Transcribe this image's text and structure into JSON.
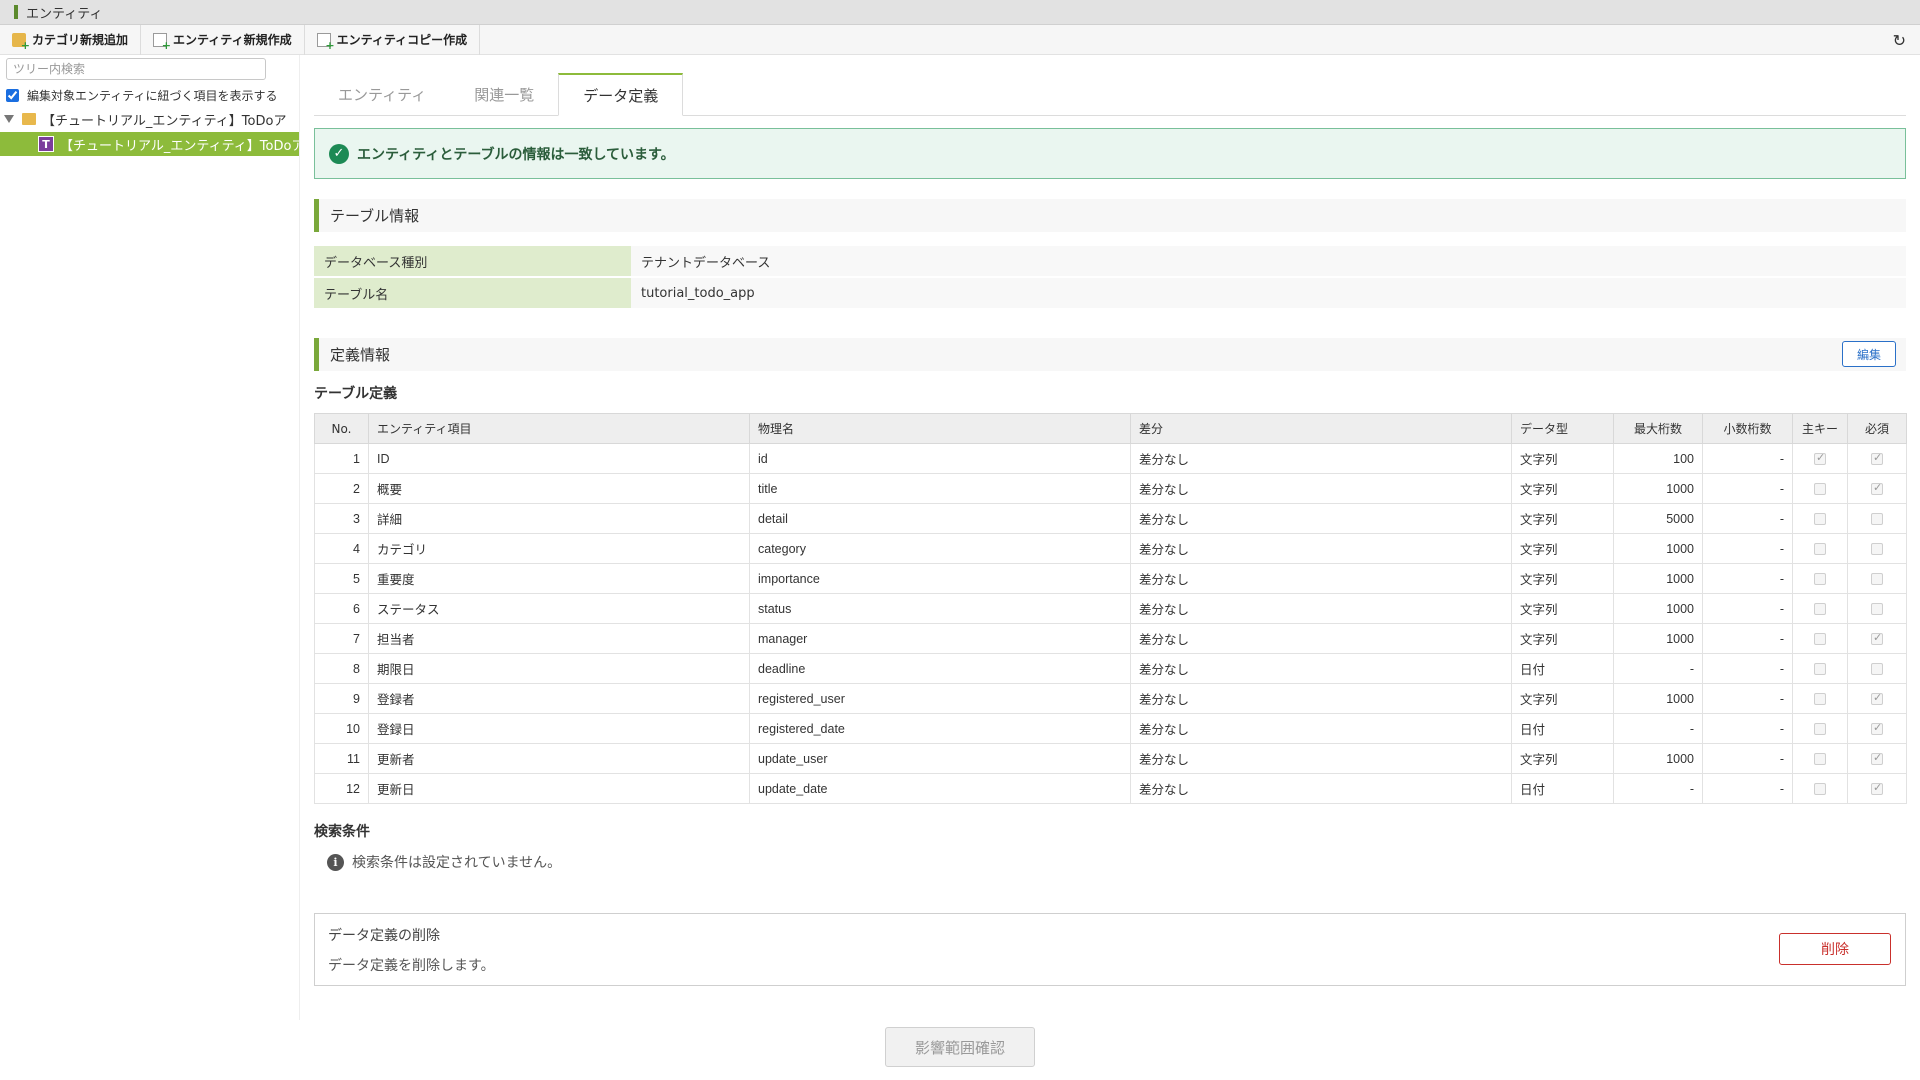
{
  "window": {
    "title": "エンティティ"
  },
  "toolbar": {
    "items": [
      {
        "label": "カテゴリ新規追加",
        "icon": "folder-add-icon"
      },
      {
        "label": "エンティティ新規作成",
        "icon": "document-add-icon"
      },
      {
        "label": "エンティティコピー作成",
        "icon": "document-copy-icon"
      }
    ],
    "refresh_icon": "refresh-icon"
  },
  "sidebar": {
    "search_placeholder": "ツリー内検索",
    "checkbox_label": "編集対象エンティティに紐づく項目を表示する",
    "checkbox_checked": true,
    "category_node": "【チュートリアル_エンティティ】ToDoア",
    "entity_node": "【チュートリアル_エンティティ】ToDoア",
    "entity_icon_letter": "T",
    "scroll_left": "◂",
    "scroll_right": "▸"
  },
  "tabs": [
    {
      "label": "エンティティ",
      "active": false
    },
    {
      "label": "関連一覧",
      "active": false
    },
    {
      "label": "データ定義",
      "active": true
    }
  ],
  "alert": {
    "icon": "✓",
    "text": "エンティティとテーブルの情報は一致しています。"
  },
  "table_info": {
    "heading": "テーブル情報",
    "rows": [
      {
        "key": "データベース種別",
        "value": "テナントデータベース"
      },
      {
        "key": "テーブル名",
        "value": "tutorial_todo_app"
      }
    ]
  },
  "definition": {
    "heading": "定義情報",
    "edit_label": "編集",
    "table_title": "テーブル定義",
    "columns": [
      "No.",
      "エンティティ項目",
      "物理名",
      "差分",
      "データ型",
      "最大桁数",
      "小数桁数",
      "主キー",
      "必須"
    ],
    "rows": [
      {
        "no": "1",
        "item": "ID",
        "physical": "id",
        "diff": "差分なし",
        "type": "文字列",
        "max": "100",
        "dec": "-",
        "pk": true,
        "req": true
      },
      {
        "no": "2",
        "item": "概要",
        "physical": "title",
        "diff": "差分なし",
        "type": "文字列",
        "max": "1000",
        "dec": "-",
        "pk": false,
        "req": true
      },
      {
        "no": "3",
        "item": "詳細",
        "physical": "detail",
        "diff": "差分なし",
        "type": "文字列",
        "max": "5000",
        "dec": "-",
        "pk": false,
        "req": false
      },
      {
        "no": "4",
        "item": "カテゴリ",
        "physical": "category",
        "diff": "差分なし",
        "type": "文字列",
        "max": "1000",
        "dec": "-",
        "pk": false,
        "req": false
      },
      {
        "no": "5",
        "item": "重要度",
        "physical": "importance",
        "diff": "差分なし",
        "type": "文字列",
        "max": "1000",
        "dec": "-",
        "pk": false,
        "req": false
      },
      {
        "no": "6",
        "item": "ステータス",
        "physical": "status",
        "diff": "差分なし",
        "type": "文字列",
        "max": "1000",
        "dec": "-",
        "pk": false,
        "req": false
      },
      {
        "no": "7",
        "item": "担当者",
        "physical": "manager",
        "diff": "差分なし",
        "type": "文字列",
        "max": "1000",
        "dec": "-",
        "pk": false,
        "req": true
      },
      {
        "no": "8",
        "item": "期限日",
        "physical": "deadline",
        "diff": "差分なし",
        "type": "日付",
        "max": "-",
        "dec": "-",
        "pk": false,
        "req": false
      },
      {
        "no": "9",
        "item": "登録者",
        "physical": "registered_user",
        "diff": "差分なし",
        "type": "文字列",
        "max": "1000",
        "dec": "-",
        "pk": false,
        "req": true
      },
      {
        "no": "10",
        "item": "登録日",
        "physical": "registered_date",
        "diff": "差分なし",
        "type": "日付",
        "max": "-",
        "dec": "-",
        "pk": false,
        "req": true
      },
      {
        "no": "11",
        "item": "更新者",
        "physical": "update_user",
        "diff": "差分なし",
        "type": "文字列",
        "max": "1000",
        "dec": "-",
        "pk": false,
        "req": true
      },
      {
        "no": "12",
        "item": "更新日",
        "physical": "update_date",
        "diff": "差分なし",
        "type": "日付",
        "max": "-",
        "dec": "-",
        "pk": false,
        "req": true
      }
    ]
  },
  "search_conditions": {
    "heading": "検索条件",
    "icon": "i",
    "message": "検索条件は設定されていません。"
  },
  "delete_section": {
    "title": "データ定義の削除",
    "description": "データ定義を削除します。",
    "button_label": "削除"
  },
  "impact_button": {
    "label": "影響範囲確認",
    "enabled": false
  },
  "colors": {
    "accent_green": "#8dbb3b",
    "section_bar": "#7aa83a",
    "success_bg": "#eaf6f0",
    "danger": "#c9302c",
    "link_blue": "#2a70c8"
  }
}
